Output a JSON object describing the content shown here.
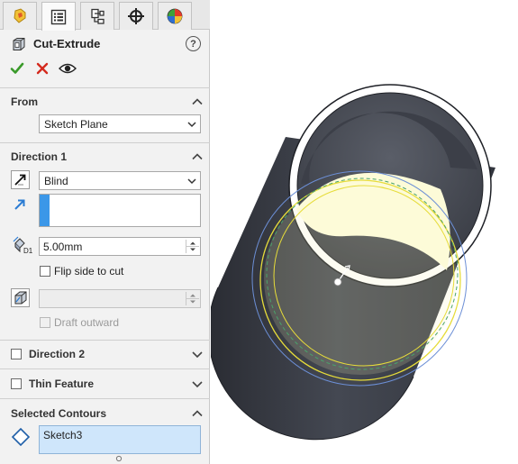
{
  "feature": {
    "title": "Cut-Extrude",
    "help_label": "?"
  },
  "tabs": [
    {
      "name": "feature-manager-tab",
      "icon": "feature-tree-icon"
    },
    {
      "name": "property-manager-tab",
      "icon": "property-manager-icon"
    },
    {
      "name": "configuration-manager-tab",
      "icon": "configuration-icon"
    },
    {
      "name": "dimxpert-tab",
      "icon": "crosshair-icon"
    },
    {
      "name": "display-manager-tab",
      "icon": "appearance-pie-icon"
    }
  ],
  "actions": {
    "ok_icon": "checkmark-icon",
    "cancel_icon": "x-icon",
    "preview_icon": "eye-icon"
  },
  "from": {
    "title": "From",
    "selected": "Sketch Plane"
  },
  "direction1": {
    "title": "Direction 1",
    "end_condition": "Blind",
    "depth": "5.00mm",
    "flip_side_label": "Flip side to cut",
    "draft_outward_label": "Draft outward"
  },
  "direction2": {
    "title": "Direction 2"
  },
  "thin_feature": {
    "title": "Thin Feature"
  },
  "selected_contours": {
    "title": "Selected Contours",
    "items": [
      "Sketch3"
    ]
  },
  "colors": {
    "ok_green": "#3a9a2a",
    "cancel_red": "#d42a1e",
    "accent_blue": "#3b97e8",
    "list_highlight": "#cfe6fb",
    "cylinder_dark": "#3c3f48",
    "sketch_fill": "#fdfbd8",
    "sketch_yellow": "#e6dc3a",
    "sketch_blue": "#6c8fd6"
  }
}
